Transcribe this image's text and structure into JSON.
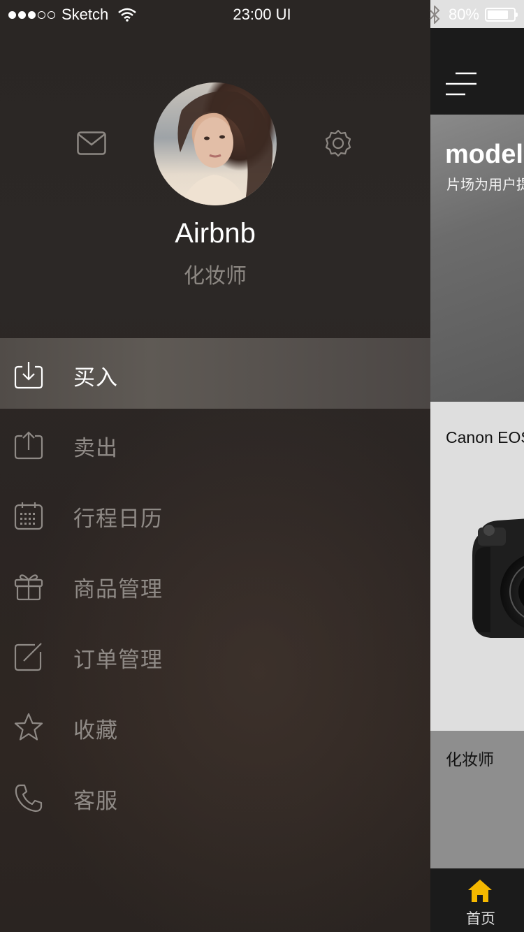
{
  "status_bar": {
    "carrier": "Sketch",
    "time": "23:00  UI",
    "battery": "80%",
    "battery_level": 0.8
  },
  "profile": {
    "name": "Airbnb",
    "role": "化妆师"
  },
  "menu": [
    {
      "label": "买入",
      "icon": "download-icon",
      "active": true
    },
    {
      "label": "卖出",
      "icon": "upload-icon",
      "active": false
    },
    {
      "label": "行程日历",
      "icon": "calendar-icon",
      "active": false
    },
    {
      "label": "商品管理",
      "icon": "gift-icon",
      "active": false
    },
    {
      "label": "订单管理",
      "icon": "edit-icon",
      "active": false
    },
    {
      "label": "收藏",
      "icon": "star-icon",
      "active": false
    },
    {
      "label": "客服",
      "icon": "phone-icon",
      "active": false
    }
  ],
  "content": {
    "hero_title": "model",
    "hero_subtitle": "片场为用户提",
    "card_title": "Canon EOS",
    "card2_title": "化妆师",
    "tab_home": "首页"
  },
  "colors": {
    "accent": "#f5b800",
    "drawer_bg": "#2b2624",
    "active_row": "#5a5551"
  }
}
